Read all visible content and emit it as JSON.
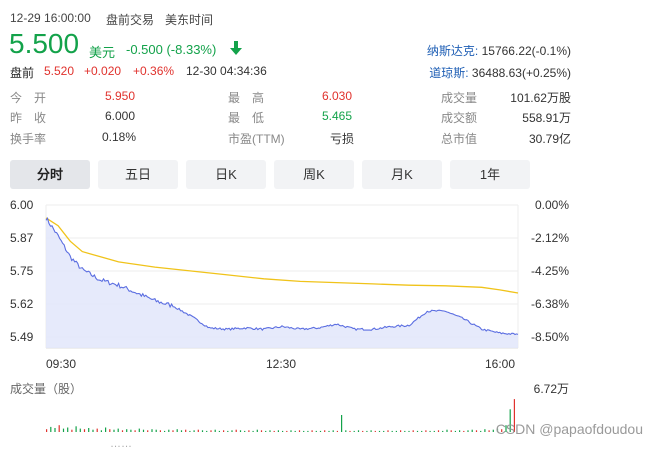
{
  "header": {
    "datetime": "12-29 16:00:00",
    "session": "盘前交易",
    "tz": "美东时间"
  },
  "quote": {
    "price": "5.500",
    "currency": "美元",
    "change": "-0.500 (-8.33%)",
    "direction_icon": "arrow-down-icon"
  },
  "premarket": {
    "label": "盘前",
    "price": "5.520",
    "change": "+0.020",
    "pct": "+0.36%",
    "time": "12-30 04:34:36"
  },
  "indices": [
    {
      "name": "纳斯达克:",
      "value": "15766.22(-0.1%)"
    },
    {
      "name": "道琼斯:",
      "value": "36488.63(+0.25%)"
    }
  ],
  "stats": {
    "open_label": "今　开",
    "open": "5.950",
    "prev_label": "昨　收",
    "prev": "6.000",
    "turnover_rate_label": "换手率",
    "turnover_rate": "0.18%",
    "high_label": "最　高",
    "high": "6.030",
    "low_label": "最　低",
    "low": "5.465",
    "pe_label": "市盈(TTM)",
    "pe": "亏损",
    "volume_label": "成交量",
    "volume": "101.62万股",
    "amount_label": "成交额",
    "amount": "558.91万",
    "mcap_label": "总市值",
    "mcap": "30.79亿"
  },
  "tabs": [
    "分时",
    "五日",
    "日K",
    "周K",
    "月K",
    "1年"
  ],
  "active_tab": 0,
  "volume_section": {
    "label": "成交量（股）",
    "max": "6.72万"
  },
  "footer_partial": "……",
  "watermark": "CSDN @papaofdoudou",
  "colors": {
    "up": "#e0322d",
    "down": "#13a24a",
    "price_line": "#5b6ee1",
    "avg_line": "#f0c31a",
    "area_fill": "#e2e6fa"
  },
  "chart_data": {
    "type": "line",
    "title": "",
    "x_ticks": [
      "09:30",
      "12:30",
      "16:00"
    ],
    "y_ticks_left": [
      "6.00",
      "5.87",
      "5.75",
      "5.62",
      "5.49"
    ],
    "y_ticks_right": [
      "0.00%",
      "-2.12%",
      "-4.25%",
      "-6.38%",
      "-8.50%"
    ],
    "ylim": [
      5.49,
      6.0
    ],
    "series": [
      {
        "x": [
          "09:30",
          "09:40",
          "09:50",
          "10:00",
          "10:15",
          "10:30",
          "10:45",
          "11:00",
          "11:15",
          "11:30",
          "11:45",
          "12:00",
          "12:15",
          "12:30",
          "12:45",
          "13:00",
          "13:15",
          "13:30",
          "13:45",
          "14:00",
          "14:15",
          "14:30",
          "14:45",
          "15:00",
          "15:15",
          "15:30",
          "15:45",
          "16:00"
        ],
        "values": [
          5.95,
          5.88,
          5.8,
          5.75,
          5.71,
          5.69,
          5.66,
          5.63,
          5.61,
          5.57,
          5.525,
          5.52,
          5.525,
          5.52,
          5.53,
          5.52,
          5.525,
          5.54,
          5.52,
          5.52,
          5.53,
          5.535,
          5.59,
          5.59,
          5.56,
          5.52,
          5.505,
          5.5
        ]
      },
      {
        "x": [
          "09:30",
          "09:40",
          "09:50",
          "10:00",
          "10:15",
          "10:30",
          "10:45",
          "11:00",
          "11:30",
          "12:00",
          "12:30",
          "13:00",
          "13:30",
          "14:00",
          "14:30",
          "15:00",
          "15:30",
          "15:45",
          "16:00"
        ],
        "values": [
          5.95,
          5.92,
          5.86,
          5.82,
          5.8,
          5.78,
          5.77,
          5.76,
          5.745,
          5.73,
          5.715,
          5.705,
          5.7,
          5.695,
          5.69,
          5.688,
          5.682,
          5.672,
          5.66
        ]
      }
    ],
    "volume_bars": [
      5,
      9,
      7,
      12,
      6,
      8,
      4,
      10,
      6,
      5,
      7,
      4,
      6,
      3,
      8,
      5,
      4,
      6,
      3,
      5,
      4,
      3,
      6,
      4,
      3,
      5,
      4,
      3,
      2,
      4,
      3,
      5,
      3,
      4,
      2,
      3,
      4,
      3,
      2,
      3,
      4,
      2,
      3,
      2,
      3,
      4,
      3,
      2,
      3,
      2,
      4,
      3,
      2,
      3,
      2,
      3,
      2,
      2,
      3,
      2,
      3,
      2,
      2,
      3,
      2,
      2,
      3,
      2,
      3,
      2,
      30,
      3,
      2,
      2,
      3,
      2,
      2,
      3,
      2,
      2,
      2,
      3,
      2,
      2,
      3,
      2,
      2,
      3,
      2,
      2,
      3,
      2,
      2,
      3,
      2,
      4,
      3,
      2,
      3,
      2,
      3,
      4,
      3,
      2,
      5,
      3,
      4,
      6,
      5,
      12,
      40,
      58
    ],
    "volume_max": 67200
  }
}
